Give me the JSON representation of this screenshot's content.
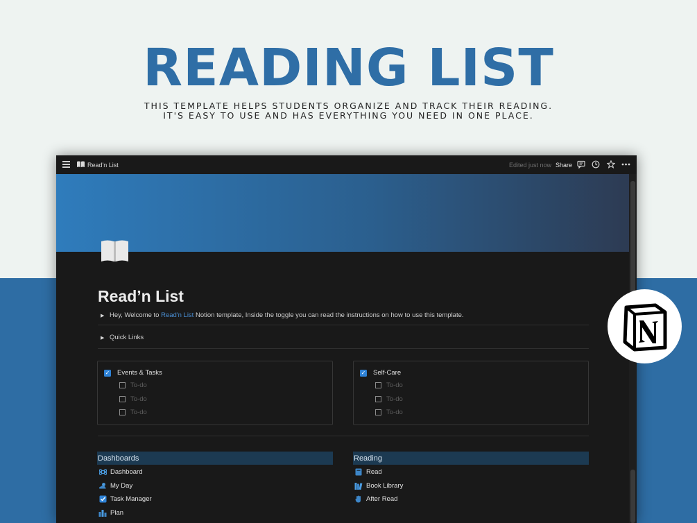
{
  "hero": {
    "title": "READING LIST",
    "subtitle_line1": "THIS TEMPLATE HELPS STUDENTS ORGANIZE AND TRACK THEIR READING.",
    "subtitle_line2": "IT'S EASY TO USE AND HAS EVERYTHING YOU NEED IN ONE PLACE."
  },
  "topbar": {
    "page_title": "Read'n List",
    "edited": "Edited just now",
    "share": "Share"
  },
  "page": {
    "title": "Read’n List",
    "intro_prefix": "Hey, Welcome to ",
    "intro_link": "Read'n List",
    "intro_suffix": " Notion template, Inside the toggle you can read the instructions on how to use this template.",
    "quick_links": "Quick Links"
  },
  "cards": [
    {
      "title": "Events & Tasks",
      "todos": [
        "To-do",
        "To-do",
        "To-do"
      ]
    },
    {
      "title": "Self-Care",
      "todos": [
        "To-do",
        "To-do",
        "To-do"
      ]
    }
  ],
  "sections": [
    {
      "title": "Dashboards",
      "items": [
        {
          "label": "Dashboard",
          "icon": "command-icon"
        },
        {
          "label": "My Day",
          "icon": "sun-cloud-icon"
        },
        {
          "label": "Task Manager",
          "icon": "checkbox-icon"
        },
        {
          "label": "Plan",
          "icon": "city-icon"
        }
      ]
    },
    {
      "title": "Reading",
      "items": [
        {
          "label": "Read",
          "icon": "book-icon"
        },
        {
          "label": "Book Library",
          "icon": "books-icon"
        },
        {
          "label": "After Read",
          "icon": "hand-icon"
        }
      ]
    }
  ],
  "colors": {
    "accent": "#2f6ea6",
    "checkbox": "#2e82d6",
    "link": "#4a8fd4",
    "section_bg": "#1c3a52"
  }
}
